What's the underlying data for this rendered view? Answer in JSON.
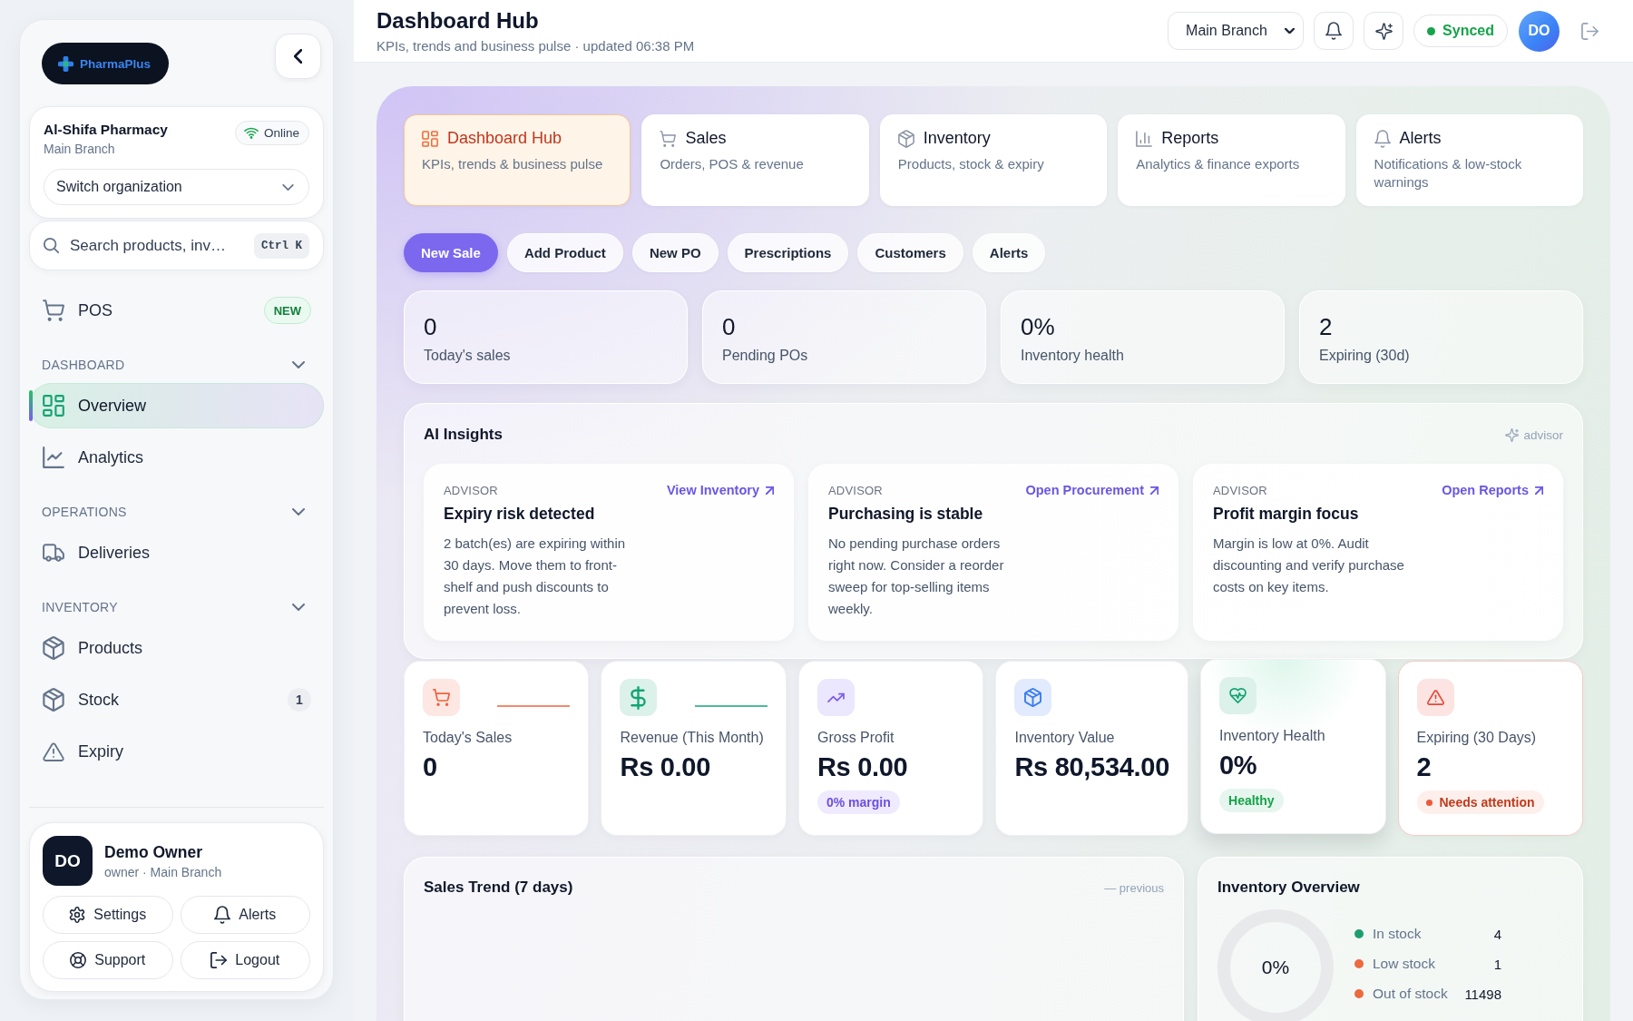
{
  "sidebar": {
    "logo": "PharmaPlus",
    "organization": {
      "name": "Al-Shifa Pharmacy",
      "branch": "Main Branch",
      "status": "Online",
      "switcher": "Switch organization"
    },
    "search": {
      "placeholder": "Search products, inv…",
      "shortcut": "Ctrl K"
    },
    "pos": {
      "label": "POS",
      "badge": "NEW",
      "selected": false
    },
    "sections": [
      {
        "title": "DASHBOARD",
        "expanded": true,
        "items": [
          {
            "label": "Overview",
            "selected": true
          },
          {
            "label": "Analytics",
            "selected": false
          }
        ]
      },
      {
        "title": "OPERATIONS",
        "expanded": true,
        "items": [
          {
            "label": "Deliveries",
            "selected": false
          }
        ]
      },
      {
        "title": "INVENTORY",
        "expanded": true,
        "items": [
          {
            "label": "Products",
            "selected": false
          },
          {
            "label": "Stock",
            "selected": false,
            "count": "1"
          },
          {
            "label": "Expiry",
            "selected": false
          }
        ]
      }
    ],
    "user": {
      "initials": "DO",
      "name": "Demo Owner",
      "role": "owner · Main Branch",
      "actions": [
        {
          "label": "Settings"
        },
        {
          "label": "Alerts"
        },
        {
          "label": "Support"
        },
        {
          "label": "Logout"
        }
      ]
    }
  },
  "header": {
    "title": "Dashboard Hub",
    "subtitle": "KPIs, trends and business pulse · updated 06:38 PM",
    "branch": "Main Branch",
    "sync_status": "Synced",
    "avatar": "DO"
  },
  "modules": [
    {
      "title": "Dashboard Hub",
      "description": "KPIs, trends & business pulse",
      "selected": true
    },
    {
      "title": "Sales",
      "description": "Orders, POS & revenue",
      "selected": false
    },
    {
      "title": "Inventory",
      "description": "Products, stock & expiry",
      "selected": false
    },
    {
      "title": "Reports",
      "description": "Analytics & finance exports",
      "selected": false
    },
    {
      "title": "Alerts",
      "description": "Notifications & low-stock warnings",
      "selected": false
    }
  ],
  "quick_actions": [
    {
      "label": "New Sale",
      "kind": "primary"
    },
    {
      "label": "Add Product",
      "kind": "secondary"
    },
    {
      "label": "New PO",
      "kind": "secondary"
    },
    {
      "label": "Prescriptions",
      "kind": "secondary"
    },
    {
      "label": "Customers",
      "kind": "secondary"
    },
    {
      "label": "Alerts",
      "kind": "secondary"
    }
  ],
  "stats": [
    {
      "value": "0",
      "label": "Today's sales"
    },
    {
      "value": "0",
      "label": "Pending POs"
    },
    {
      "value": "0%",
      "label": "Inventory health"
    },
    {
      "value": "2",
      "label": "Expiring (30d)"
    }
  ],
  "ai_insights": {
    "title": "AI Insights",
    "tag": "advisor",
    "cards": [
      {
        "eyebrow": "ADVISOR",
        "title": "Expiry risk detected",
        "body": "2 batch(es) are expiring within 30 days. Move them to front-shelf and push discounts to prevent loss.",
        "link": "View Inventory"
      },
      {
        "eyebrow": "ADVISOR",
        "title": "Purchasing is stable",
        "body": "No pending purchase orders right now. Consider a reorder sweep for top-selling items weekly.",
        "link": "Open Procurement"
      },
      {
        "eyebrow": "ADVISOR",
        "title": "Profit margin focus",
        "body": "Margin is low at 0%. Audit discounting and verify purchase costs on key items.",
        "link": "Open Reports"
      }
    ]
  },
  "kpis": [
    {
      "label": "Today's Sales",
      "value": "0",
      "color": "#f0623c",
      "sparkline": true,
      "highlighted": false
    },
    {
      "label": "Revenue (This Month)",
      "value": "Rs 0.00",
      "color": "#14a472",
      "sparkline": true,
      "highlighted": false
    },
    {
      "label": "Gross Profit",
      "value": "Rs 0.00",
      "color": "#7c5cf0",
      "sparkline": false,
      "highlighted": false,
      "badge": {
        "text": "0% margin",
        "kind": "info"
      }
    },
    {
      "label": "Inventory Value",
      "value": "Rs 80,534.00",
      "color": "#3b7cf0",
      "sparkline": false,
      "highlighted": false
    },
    {
      "label": "Inventory Health",
      "value": "0%",
      "color": "#14a472",
      "sparkline": false,
      "highlighted": true,
      "badge": {
        "text": "Healthy",
        "kind": "success"
      }
    },
    {
      "label": "Expiring (30 Days)",
      "value": "2",
      "color": "#e5483a",
      "sparkline": false,
      "highlighted": false,
      "badge": {
        "text": "Needs attention",
        "kind": "danger"
      }
    }
  ],
  "sales_trend": {
    "title": "Sales Trend (7 days)",
    "legend": "— previous"
  },
  "inventory_overview": {
    "title": "Inventory Overview",
    "ring_label": "0%",
    "legend": [
      {
        "label": "In stock",
        "value": "4",
        "color": "#1f9d6e"
      },
      {
        "label": "Low stock",
        "value": "1",
        "color": "#ec6a3e"
      },
      {
        "label": "Out of stock",
        "value": "11498",
        "color": "#ec6a3e"
      }
    ]
  }
}
